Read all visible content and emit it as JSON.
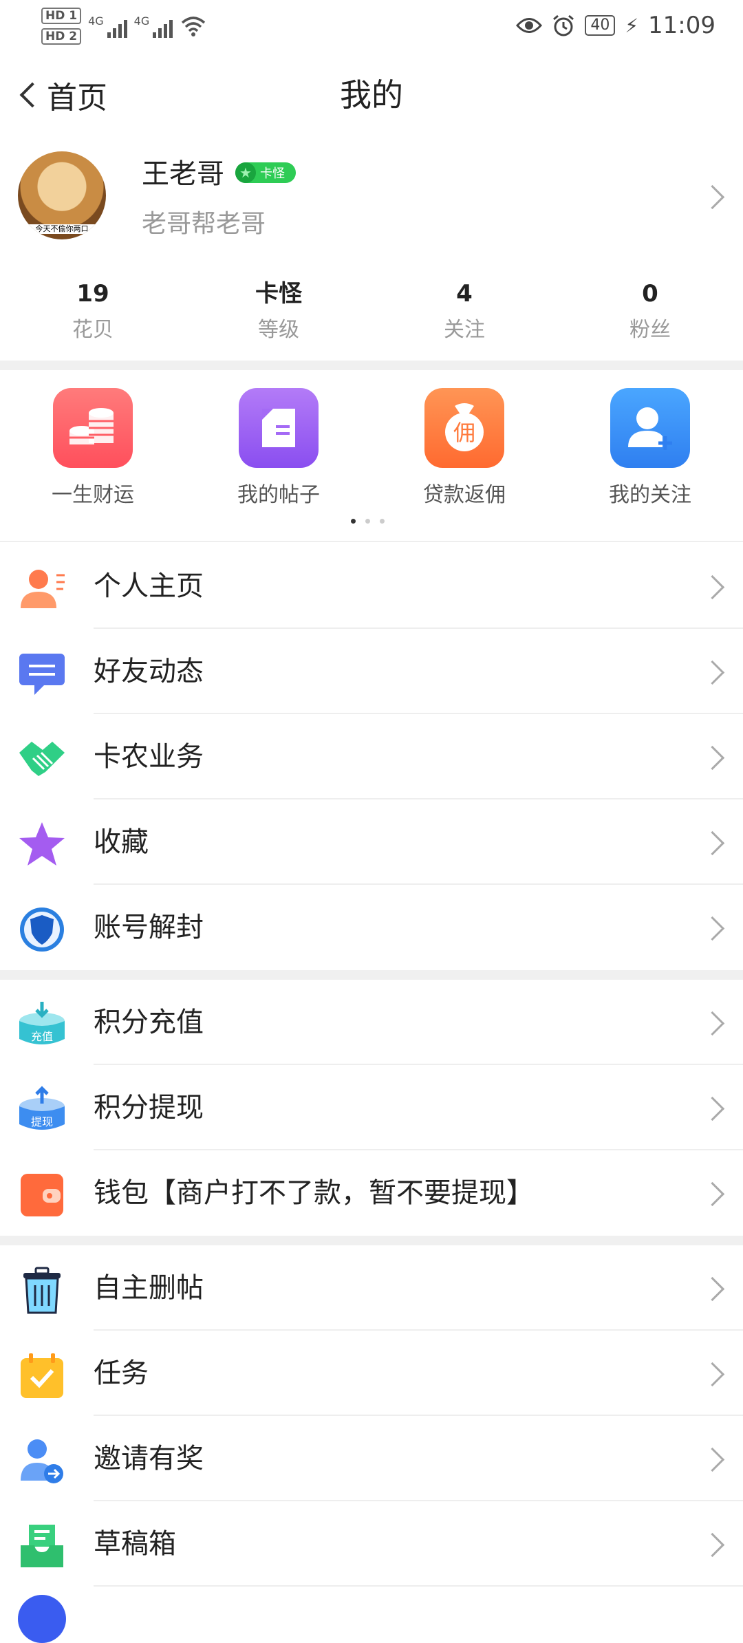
{
  "status_bar": {
    "hd1": "HD 1",
    "hd2": "HD 2",
    "net1": "4G",
    "net2": "4G",
    "battery": "40",
    "time": "11:09"
  },
  "header": {
    "back_label": "首页",
    "title": "我的"
  },
  "profile": {
    "name": "王老哥",
    "badge": "卡怪",
    "subtitle": "老哥帮老哥",
    "avatar_caption": "今天不偷你两口"
  },
  "stats": [
    {
      "value": "19",
      "label": "花贝"
    },
    {
      "value": "卡怪",
      "label": "等级"
    },
    {
      "value": "4",
      "label": "关注"
    },
    {
      "value": "0",
      "label": "粉丝"
    }
  ],
  "quick_actions": [
    {
      "label": "一生财运",
      "icon": "coins-icon",
      "color": "#ff5f5f"
    },
    {
      "label": "我的帖子",
      "icon": "post-icon",
      "color": "#9c5cf2"
    },
    {
      "label": "贷款返佣",
      "icon": "money-bag-icon",
      "color": "#ff7a3c"
    },
    {
      "label": "我的关注",
      "icon": "add-user-icon",
      "color": "#2f8df2"
    }
  ],
  "menu_groups": [
    [
      {
        "label": "个人主页",
        "icon": "person-icon"
      },
      {
        "label": "好友动态",
        "icon": "chat-icon"
      },
      {
        "label": "卡农业务",
        "icon": "handshake-icon"
      },
      {
        "label": "收藏",
        "icon": "star-icon"
      },
      {
        "label": "账号解封",
        "icon": "shield-icon"
      }
    ],
    [
      {
        "label": "积分充值",
        "icon": "recharge-icon",
        "badge": "充值"
      },
      {
        "label": "积分提现",
        "icon": "withdraw-icon",
        "badge": "提现"
      },
      {
        "label": "钱包【商户打不了款，暂不要提现】",
        "icon": "wallet-icon"
      }
    ],
    [
      {
        "label": "自主删帖",
        "icon": "trash-icon"
      },
      {
        "label": "任务",
        "icon": "task-icon"
      },
      {
        "label": "邀请有奖",
        "icon": "invite-icon"
      },
      {
        "label": "草稿箱",
        "icon": "draft-icon"
      }
    ]
  ]
}
